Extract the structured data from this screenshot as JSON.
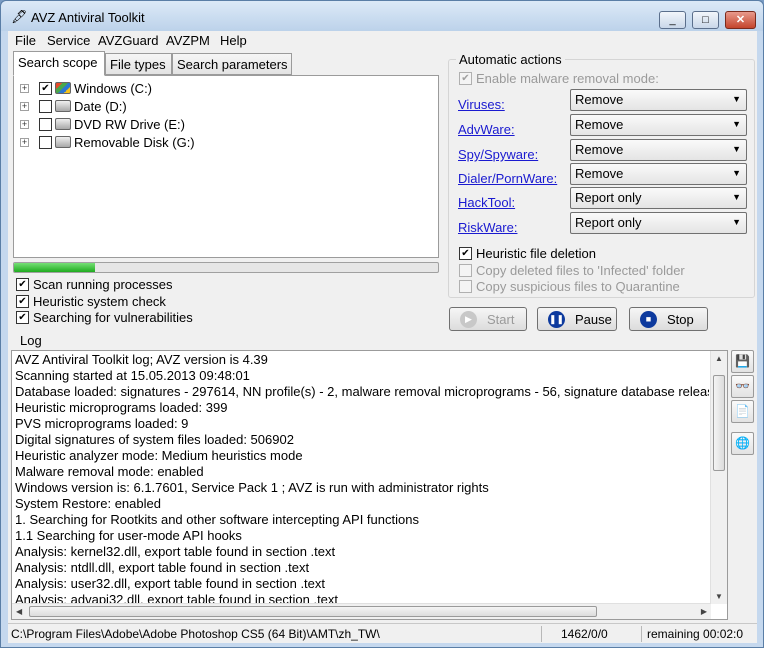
{
  "window": {
    "title": "AVZ Antiviral Toolkit",
    "minimize": "_",
    "maximize": "□",
    "close": "✕"
  },
  "menu": [
    "File",
    "Service",
    "AVZGuard",
    "AVZPM",
    "Help"
  ],
  "tabs": [
    "Search scope",
    "File types",
    "Search parameters"
  ],
  "active_tab": "Search scope",
  "drives": [
    {
      "label": "Windows (C:)",
      "checked": true,
      "icon": "windows-drive-icon"
    },
    {
      "label": "Date (D:)",
      "checked": false,
      "icon": "hard-drive-icon"
    },
    {
      "label": "DVD RW Drive (E:)",
      "checked": false,
      "icon": "dvd-drive-icon"
    },
    {
      "label": "Removable Disk (G:)",
      "checked": false,
      "icon": "removable-disk-icon"
    }
  ],
  "scan_progress": 0.19,
  "scan_options": [
    {
      "label": "Scan running processes",
      "checked": true
    },
    {
      "label": "Heuristic system check",
      "checked": true
    },
    {
      "label": "Searching for vulnerabilities",
      "checked": true
    }
  ],
  "auto_actions": {
    "title": "Automatic actions",
    "enable_removal": {
      "label": "Enable malware removal mode:",
      "checked": true,
      "disabled": true
    },
    "rows": [
      {
        "label": "Viruses:",
        "value": "Remove"
      },
      {
        "label": "AdvWare:",
        "value": "Remove"
      },
      {
        "label": "Spy/Spyware:",
        "value": "Remove"
      },
      {
        "label": "Dialer/PornWare:",
        "value": "Remove"
      },
      {
        "label": "HackTool:",
        "value": "Report only"
      },
      {
        "label": "RiskWare:",
        "value": "Report only"
      }
    ],
    "heuristic_deletion": {
      "label": "Heuristic file deletion",
      "checked": true
    },
    "copy_infected": {
      "label": "Copy deleted files to 'Infected' folder",
      "checked": false,
      "disabled": true
    },
    "copy_quarantine": {
      "label": "Copy suspicious files to Quarantine",
      "checked": false,
      "disabled": true
    }
  },
  "buttons": {
    "start": "Start",
    "pause": "Pause",
    "stop": "Stop"
  },
  "log": {
    "title": "Log",
    "lines": [
      "AVZ Antiviral Toolkit log; AVZ version is 4.39",
      "Scanning started at 15.05.2013 09:48:01",
      "Database loaded: signatures - 297614, NN profile(s) - 2, malware removal microprograms - 56, signature database releas",
      "Heuristic microprograms loaded: 399",
      "PVS microprograms loaded: 9",
      "Digital signatures of system files loaded: 506902",
      "Heuristic analyzer mode: Medium heuristics mode",
      "Malware removal mode: enabled",
      "Windows version is: 6.1.7601, Service Pack 1 ; AVZ is run with administrator rights",
      "System Restore: enabled",
      "1. Searching for Rootkits and other software intercepting API functions",
      "1.1 Searching for user-mode API hooks",
      " Analysis: kernel32.dll, export table found in section .text",
      " Analysis: ntdll.dll, export table found in section .text",
      " Analysis: user32.dll, export table found in section .text",
      " Analysis: advapi32.dll, export table found in section .text"
    ],
    "side_buttons": [
      "save-icon",
      "glasses-icon",
      "new-document-icon",
      "globe-icon"
    ]
  },
  "status": {
    "path": "C:\\Program Files\\Adobe\\Adobe Photoshop CS5 (64 Bit)\\AMT\\zh_TW\\",
    "count": "1462/0/0",
    "remaining": "remaining 00:02:0"
  }
}
